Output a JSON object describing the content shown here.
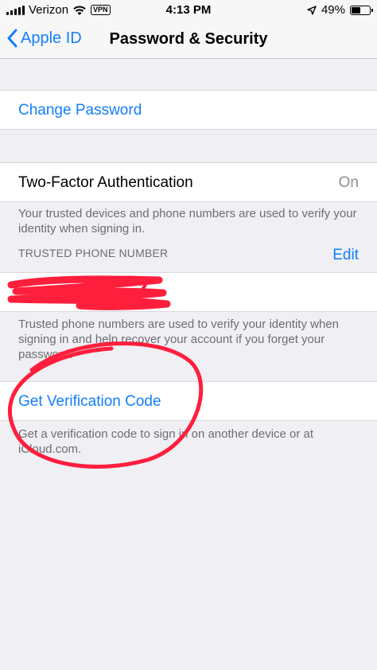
{
  "status_bar": {
    "carrier": "Verizon",
    "vpn": "VPN",
    "time": "4:13 PM",
    "battery": "49%",
    "battery_level": 0.49
  },
  "nav": {
    "back_label": "Apple ID",
    "title": "Password & Security"
  },
  "change_password": {
    "label": "Change Password"
  },
  "two_factor": {
    "label": "Two-Factor Authentication",
    "value": "On",
    "footer": "Your trusted devices and phone numbers are used to verify your identity when signing in."
  },
  "trusted_phone": {
    "header": "TRUSTED PHONE NUMBER",
    "edit_label": "Edit",
    "footer": "Trusted phone numbers are used to verify your identity when signing in and help recover your account if you forget your password."
  },
  "verification": {
    "label": "Get Verification Code",
    "footer": "Get a verification code to sign in on another device or at iCloud.com."
  },
  "colors": {
    "accent": "#147efb",
    "annotation": "#ff1f3d",
    "background": "#efeff4"
  },
  "icons": [
    "wifi-icon",
    "location-arrow-icon",
    "battery-icon",
    "chevron-left-icon"
  ]
}
